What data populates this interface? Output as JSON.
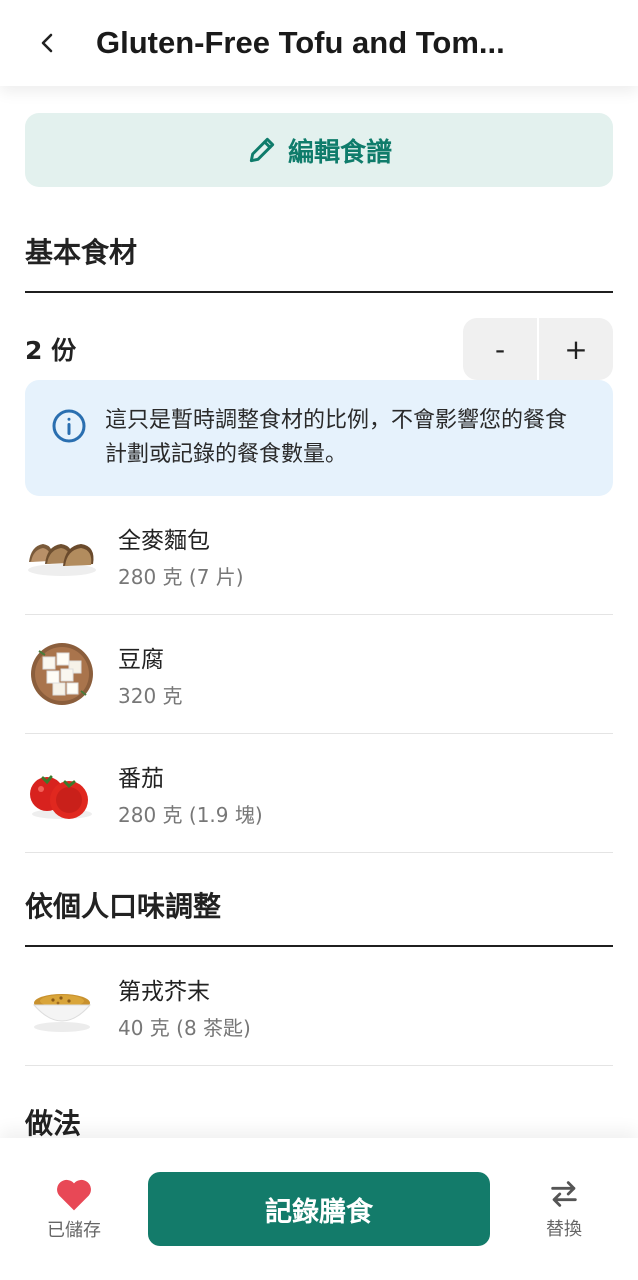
{
  "header": {
    "title": "Gluten-Free Tofu and Tom..."
  },
  "edit": {
    "label": "編輯食譜"
  },
  "basic": {
    "title": "基本食材",
    "servings": "2 份",
    "minus": "-",
    "plus": "+",
    "info": "這只是暫時調整食材的比例，不會影響您的餐食計劃或記錄的餐食數量。",
    "items": [
      {
        "name": "全麥麵包",
        "qty": "280 克 (7 片)",
        "icon": "bread-slices"
      },
      {
        "name": "豆腐",
        "qty": "320 克",
        "icon": "tofu-bowl"
      },
      {
        "name": "番茄",
        "qty": "280 克 (1.9 塊)",
        "icon": "tomatoes"
      }
    ]
  },
  "taste": {
    "title": "依個人口味調整",
    "items": [
      {
        "name": "第戎芥末",
        "qty": "40 克 (8 茶匙)",
        "icon": "mustard-bowl"
      }
    ]
  },
  "method": {
    "title": "做法"
  },
  "bottom": {
    "saved_label": "已儲存",
    "log_label": "記錄膳食",
    "swap_label": "替換"
  },
  "colors": {
    "accent": "#137b6a",
    "edit_bg": "#e3f1ee",
    "info_bg": "#e6f2fc",
    "heart": "#e84856"
  }
}
